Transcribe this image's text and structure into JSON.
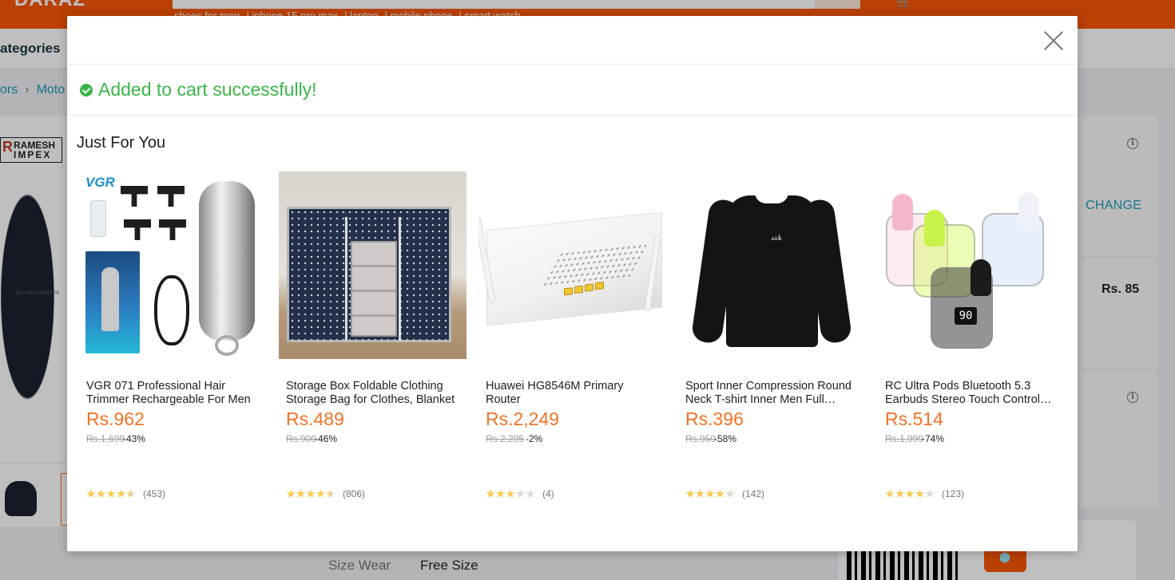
{
  "header": {
    "logo_text": "DARAZ",
    "search_suggestions": [
      "shoes for men",
      "iphone 15 pro max",
      "laptop",
      "mobile phone",
      "smart watch"
    ]
  },
  "nav": {
    "categories_label": "ategories"
  },
  "breadcrumb": {
    "items": [
      "ors",
      "Moto"
    ]
  },
  "product_page": {
    "brand_line1": "RAMESH",
    "brand_line2": "IMPEX",
    "watermark": "BUY ON DARAZ.PK",
    "change_label": "CHANGE",
    "side_price": "Rs. 85",
    "size_label": "Size Wear",
    "size_value": "Free Size"
  },
  "modal": {
    "success_message": "Added to cart successfully!",
    "section_title": "Just For You",
    "products": [
      {
        "name": "VGR 071 Professional Hair Trimmer Rechargeable For Men",
        "price": "Rs.962",
        "original_price": "Rs.1,699",
        "discount": "-43%",
        "rating": 4.5,
        "rating_count": "(453)",
        "image": "hair-trimmer-image"
      },
      {
        "name": "Storage Box Foldable Clothing Storage Bag for Clothes, Blanket",
        "price": "Rs.489",
        "original_price": "Rs.900",
        "discount": "-46%",
        "rating": 4.5,
        "rating_count": "(806)",
        "image": "storage-box-image"
      },
      {
        "name": "Huawei HG8546M Primary Router",
        "price": "Rs.2,249",
        "original_price": "Rs.2,295",
        "discount": "-2%",
        "rating": 3,
        "rating_count": "(4)",
        "image": "router-image"
      },
      {
        "name": "Sport Inner Compression Round Neck T-shirt Inner Men Full Sleeve",
        "price": "Rs.396",
        "original_price": "Rs.950",
        "discount": "-58%",
        "rating": 4,
        "rating_count": "(142)",
        "image": "tshirt-image"
      },
      {
        "name": "RC Ultra Pods Bluetooth 5.3 Earbuds Stereo Touch Control Headset",
        "price": "Rs.514",
        "original_price": "Rs.1,999",
        "discount": "-74%",
        "rating": 4,
        "rating_count": "(123)",
        "image": "earbuds-image"
      }
    ],
    "earbuds_display": "90"
  },
  "colors": {
    "brand_orange": "#f85606",
    "price_orange": "#f57224",
    "success_green": "#3bb54a",
    "link_blue": "#1a9cb7",
    "star_gold": "#faca51"
  }
}
